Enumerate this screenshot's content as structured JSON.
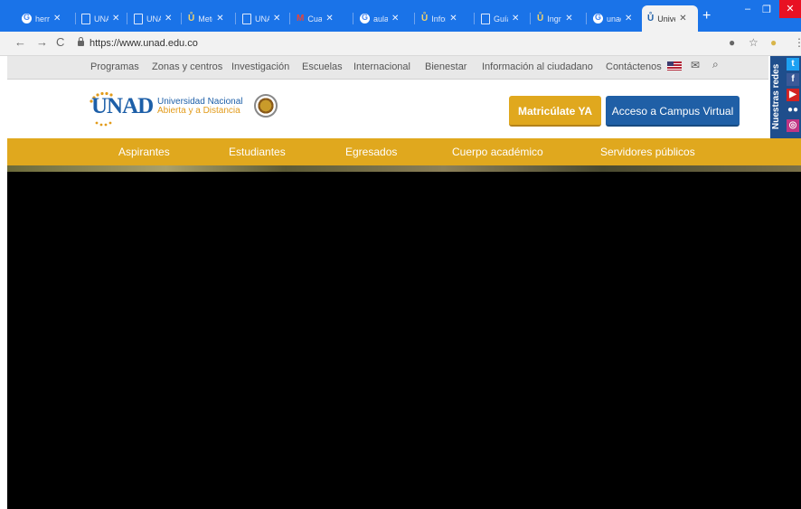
{
  "browser": {
    "tabs": [
      {
        "label": "herra",
        "favicon": "google-icon"
      },
      {
        "label": "UNA",
        "favicon": "doc-icon"
      },
      {
        "label": "UNA",
        "favicon": "doc-icon"
      },
      {
        "label": "Metc",
        "favicon": "unad-icon"
      },
      {
        "label": "UNA",
        "favicon": "doc-icon"
      },
      {
        "label": "Cuar",
        "favicon": "gmail-icon"
      },
      {
        "label": "aula",
        "favicon": "google-icon"
      },
      {
        "label": "Infor",
        "favicon": "unad-icon"
      },
      {
        "label": "Guía",
        "favicon": "doc-icon"
      },
      {
        "label": "Ingre",
        "favicon": "unad-icon"
      },
      {
        "label": "unad",
        "favicon": "google-icon"
      },
      {
        "label": "Unive",
        "favicon": "unad-icon",
        "active": true
      }
    ],
    "url": "https://www.unad.edu.co"
  },
  "site": {
    "top_links": [
      "Programas",
      "Zonas y centros",
      "Investigación",
      "Escuelas",
      "Internacional",
      "Bienestar",
      "Información al ciudadano",
      "Contáctenos"
    ],
    "logo_word": "UNAD",
    "logo_line1": "Universidad Nacional",
    "logo_line2": "Abierta y a Distancia",
    "btn_matricula": "Matricúlate YA",
    "btn_campus": "Acceso a Campus Virtual",
    "social_label": "Nuestras redes",
    "social_icons": [
      "twitter-icon",
      "facebook-icon",
      "youtube-icon",
      "flickr-icon",
      "instagram-icon"
    ],
    "main_nav": [
      "Aspirantes",
      "Estudiantes",
      "Egresados",
      "Cuerpo académico",
      "Servidores públicos"
    ]
  },
  "colors": {
    "tab_bar": "#1a73e8",
    "nav_gold": "#e0a81e",
    "campus_blue": "#1f5fa6",
    "social_blue": "#1f4e8c"
  }
}
